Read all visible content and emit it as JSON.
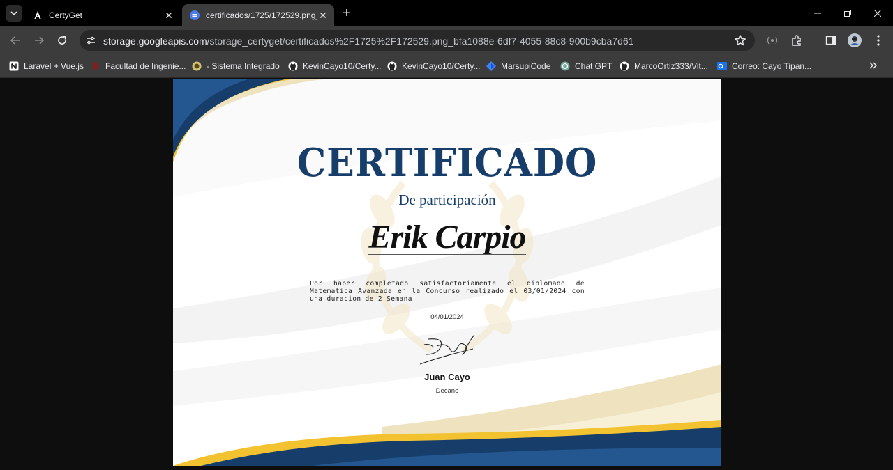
{
  "tabs": [
    {
      "title": "CertyGet",
      "icon": "angular-icon"
    },
    {
      "title": "certificados/1725/172529.png_bfa1088e",
      "icon": "storage-icon"
    }
  ],
  "address": {
    "host": "storage.googleapis.com",
    "path": "/storage_certyget/certificados%2F1725%2F172529.png_bfa1088e-6df7-4055-88c8-900b9cba7d61"
  },
  "bookmarks": [
    {
      "label": "Laravel + Vue.js",
      "icon": "notion-icon"
    },
    {
      "label": "Facultad de Ingenie...",
      "icon": "university-icon"
    },
    {
      "label": "- Sistema Integrado",
      "icon": "seal-icon"
    },
    {
      "label": "KevinCayo10/Certy...",
      "icon": "github-icon"
    },
    {
      "label": "KevinCayo10/Certy...",
      "icon": "github-icon"
    },
    {
      "label": "MarsupiCode",
      "icon": "diamond-icon"
    },
    {
      "label": "Chat GPT",
      "icon": "openai-icon"
    },
    {
      "label": "MarcoOrtiz333/Vit...",
      "icon": "github-icon"
    },
    {
      "label": "Correo: Cayo Tipan...",
      "icon": "outlook-icon"
    }
  ],
  "certificate": {
    "title": "CERTIFICADO",
    "subtitle": "De participación",
    "recipient": "Erik Carpio",
    "body": "Por haber completado satisfactoriamente el diplomado de Matemática Avanzada en la Concurso realizado el 03/01/2024 con una duracion de 2 Semana",
    "date": "04/01/2024",
    "signer_name": "Juan Cayo",
    "signer_role": "Decano",
    "colors": {
      "navy": "#173e6b",
      "gold": "#f2c230",
      "cream": "#efe3bf"
    }
  }
}
